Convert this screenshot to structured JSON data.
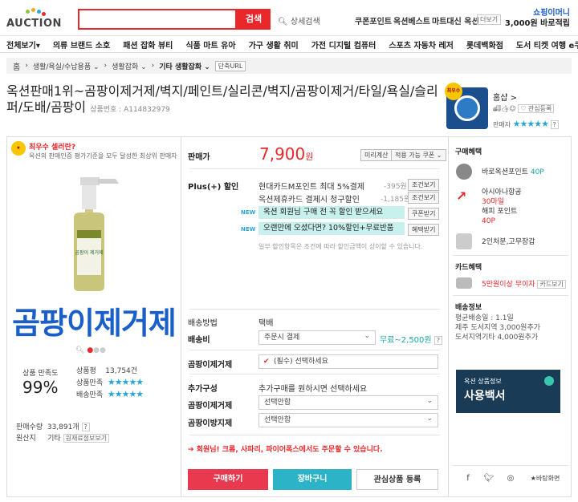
{
  "logo": {
    "text": "AUCTION"
  },
  "search": {
    "placeholder": "",
    "button": "검색",
    "detail": "상세검색"
  },
  "top_links": [
    "쿠폰포인트",
    "옥션베스트",
    "마트대신 옥션"
  ],
  "top_more": "더보기",
  "promo": {
    "line1": "쇼핑이머니",
    "line2": "3,000원 바로적립"
  },
  "nav": [
    "전체보기",
    "의류 브랜드 소호",
    "패션 잡화 뷰티",
    "식품 마트 유아",
    "가구 생활 취미",
    "가전 디지털 컴퓨터",
    "스포츠 자동차 레저",
    "롯데백화점",
    "도서 티켓 여행 e쿠폰"
  ],
  "nav_arrow": "▾",
  "breadcrumb": {
    "home": "홈",
    "items": [
      "생활/욕실/수납용품",
      "생활잡화",
      "기타 생활잡화"
    ],
    "url_btn": "단축URL"
  },
  "product": {
    "title": "옥션판매1위~곰팡이제거제/벽지/페인트/실리콘/벽지/곰팡이제거/타일/욕실/슬리퍼/도배/곰팡이",
    "product_no": "상품번호 : A114832979"
  },
  "seller": {
    "badge": "최우수",
    "name": "홈샵",
    "more": ">",
    "fav": "관심등록",
    "rating_label": "판매자",
    "rating_q": "?"
  },
  "best_box": {
    "title": "최우수 셀러란?",
    "desc": "옥션의 판매인증 평가기준을 모두 달성한 최상위 판매자"
  },
  "image_text": "곰팡이제거제",
  "bottle_label": "곰팡이 제거제",
  "satisfaction": {
    "label": "상품 만족도",
    "value": "99%"
  },
  "stats": [
    {
      "k": "상품평",
      "v": "13,754건"
    },
    {
      "k": "상품만족",
      "v": "★★★★★"
    },
    {
      "k": "배송만족",
      "v": "★★★★★"
    }
  ],
  "sales": {
    "label": "판매수량",
    "value": "33,891개",
    "q": "?"
  },
  "origin": {
    "label": "원산지",
    "value": "기타",
    "btn": "원재료정보보기"
  },
  "price": {
    "label": "판매가",
    "value": "7,900",
    "unit": "원",
    "btn_calc": "미리계산",
    "btn_coupon": "적용 가능 쿠폰"
  },
  "plus": {
    "label": "Plus(+) 할인",
    "rows": [
      {
        "t": "현대카드M포인트 최대 5%결제",
        "d": "-395원",
        "b": "조건보기"
      },
      {
        "t": "옥션제휴카드 결제시 청구할인",
        "d": "-1,185원",
        "b": "조건보기"
      }
    ]
  },
  "banners": [
    {
      "tag": "NEW",
      "t": "옥션 회원님 구매 전 꼭 할인 받으세요",
      "b": "쿠폰받기"
    },
    {
      "tag": "NEW",
      "t": "오랜만에 오셨다면? 10%할인+무료반품",
      "b": "혜택받기"
    }
  ],
  "note": "일부 할인항목은 조건에 따라 할인금액이 상이할 수 있습니다.",
  "shipping": {
    "method_label": "배송방법",
    "method": "택배",
    "fee_label": "배송비",
    "fee_select": "주문시 결제",
    "fee_range": "무료~2,500원",
    "fee_q": "?"
  },
  "opt1": {
    "label": "곰팡이제거제",
    "value": "(필수) 선택하세요"
  },
  "add": {
    "label": "추가구성",
    "desc": "추가구매를 원하시면 선택하세요"
  },
  "opt2": {
    "label": "곰팡이제거제",
    "value": "선택안함"
  },
  "opt3": {
    "label": "곰팡이방지제",
    "value": "선택안함"
  },
  "warning": "회원님! 크롬, 사파리, 파이어폭스에서도 주문할 수 있습니다.",
  "actions": {
    "buy": "구매하기",
    "cart": "장바구니",
    "fav": "관심상품 등록"
  },
  "benefits": {
    "title": "구매혜택",
    "points": "바로옥션포인트",
    "points_val": "40P",
    "air1": "아시아나항공",
    "air2": "30마일",
    "air3": "해피 포인트",
    "air4": "40P",
    "gift": "2인처분,고무장갑"
  },
  "card": {
    "title": "카드혜택",
    "t": "5만원이상 무이자",
    "btn": "카드보기"
  },
  "delivery": {
    "title": "배송정보",
    "l1": "평균배송일 : 1.1일",
    "l2": "제주 도서지역 3,000원추가",
    "l3": "도서지역기타 4,000원추가"
  },
  "ship_banner": {
    "l1": "옥션 상품정보",
    "l2": "사용백서"
  },
  "share": {
    "report": "바탕화면"
  },
  "colors": {
    "red": "#e8282b",
    "blue": "#1a5fc9",
    "mint": "#c8f0ec",
    "star": "#2aa5d8"
  }
}
